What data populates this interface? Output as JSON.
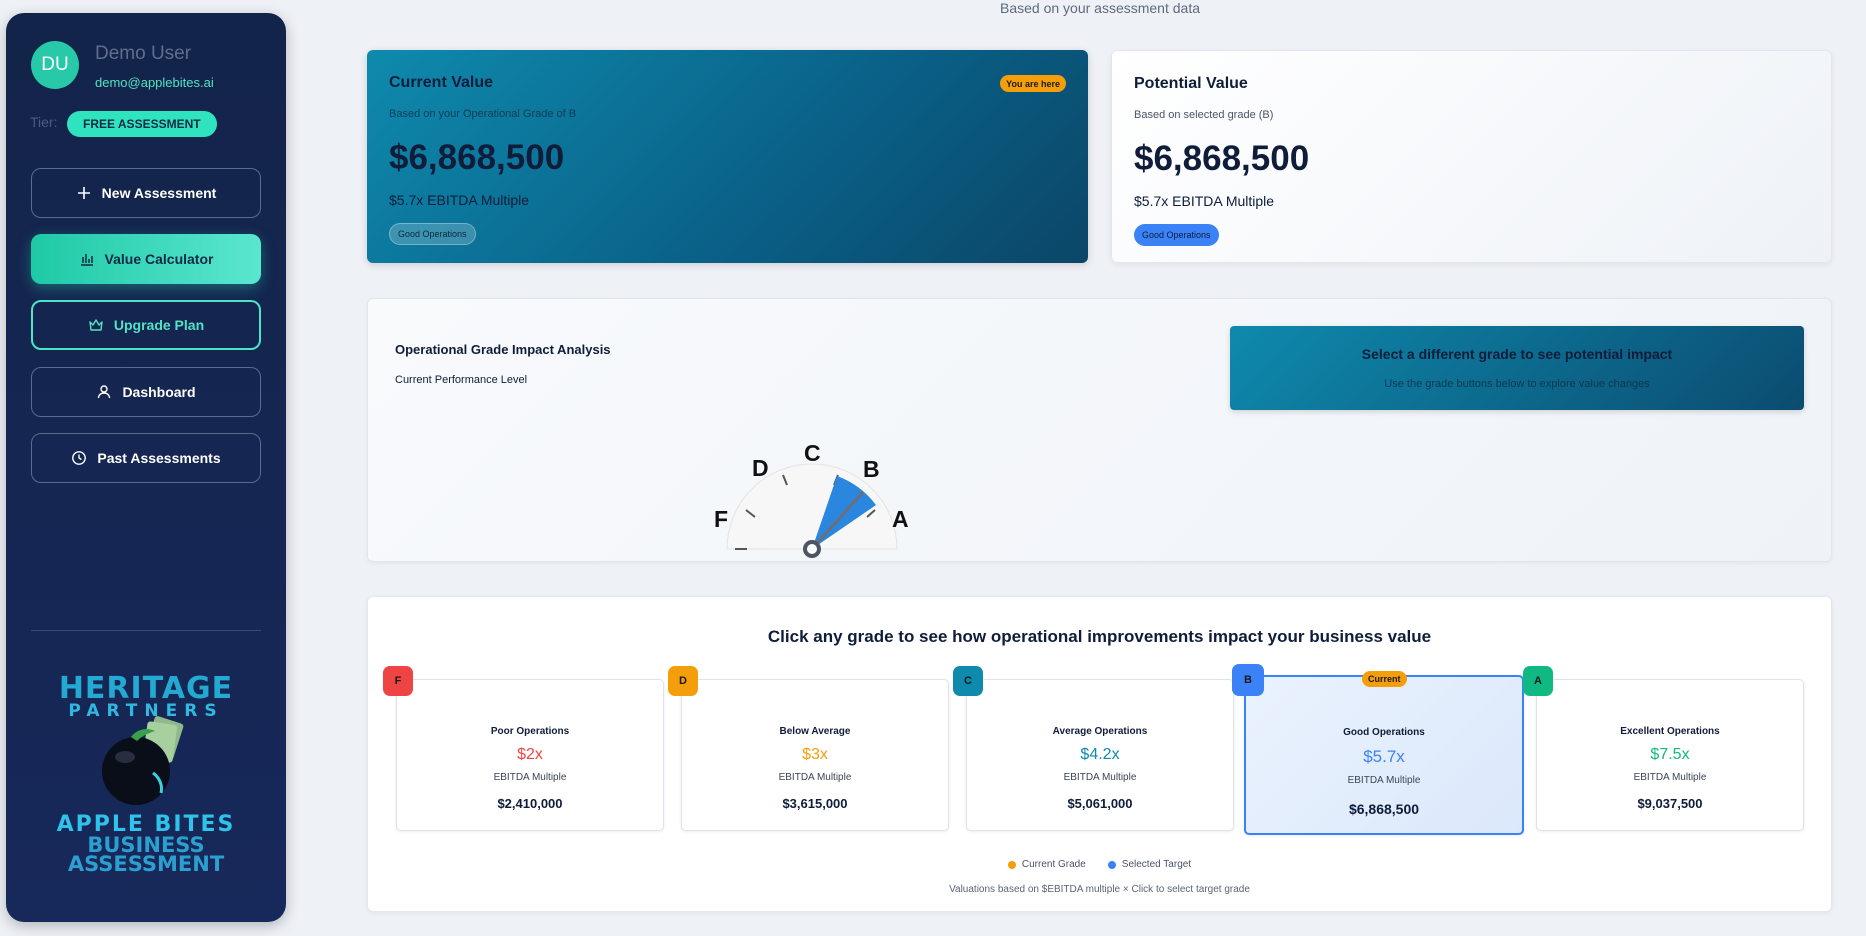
{
  "sidebar": {
    "avatar_initials": "DU",
    "user_name": "Demo User",
    "user_email": "demo@applebites.ai",
    "tier_label": "Tier:",
    "tier_badge": "FREE ASSESSMENT",
    "nav": {
      "new_assessment": "New Assessment",
      "value_calculator": "Value Calculator",
      "upgrade_plan": "Upgrade Plan",
      "dashboard": "Dashboard",
      "past_assessments": "Past Assessments"
    },
    "logo": {
      "line1": "HERITAGE",
      "line2": "PARTNERS",
      "line3": "APPLE BITES",
      "line4": "BUSINESS",
      "line5": "ASSESSMENT"
    }
  },
  "header": {
    "subtitle": "Based on your assessment data"
  },
  "current_value": {
    "title": "Current Value",
    "badge": "You are here",
    "subtitle": "Based on your Operational Grade of B",
    "value": "$6,868,500",
    "multiple": "$5.7x EBITDA Multiple",
    "pill": "Good Operations"
  },
  "potential_value": {
    "title": "Potential Value",
    "subtitle": "Based on selected grade (B)",
    "value": "$6,868,500",
    "multiple": "$5.7x EBITDA Multiple",
    "pill": "Good Operations"
  },
  "analysis": {
    "title": "Operational Grade Impact Analysis",
    "subtitle": "Current Performance Level",
    "gauge_labels": [
      "F",
      "D",
      "C",
      "B",
      "A"
    ],
    "gauge_current_grade": "B",
    "impact_title": "Select a different grade to see potential impact",
    "impact_subtitle": "Use the grade buttons below to explore value changes"
  },
  "grades": {
    "title": "Click any grade to see how operational improvements impact your business value",
    "current_tag": "Current",
    "items": [
      {
        "grade": "F",
        "name": "Poor Operations",
        "multiple": "$2x",
        "multiple_label": "EBITDA Multiple",
        "value": "$2,410,000",
        "color": "#ef4444"
      },
      {
        "grade": "D",
        "name": "Below Average",
        "multiple": "$3x",
        "multiple_label": "EBITDA Multiple",
        "value": "$3,615,000",
        "color": "#f59e0b"
      },
      {
        "grade": "C",
        "name": "Average Operations",
        "multiple": "$4.2x",
        "multiple_label": "EBITDA Multiple",
        "value": "$5,061,000",
        "color": "#0e8aad"
      },
      {
        "grade": "B",
        "name": "Good Operations",
        "multiple": "$5.7x",
        "multiple_label": "EBITDA Multiple",
        "value": "$6,868,500",
        "color": "#3b82f6"
      },
      {
        "grade": "A",
        "name": "Excellent Operations",
        "multiple": "$7.5x",
        "multiple_label": "EBITDA Multiple",
        "value": "$9,037,500",
        "color": "#10b981"
      }
    ],
    "legend": {
      "current": "Current Grade",
      "selected": "Selected Target",
      "current_color": "#f59e0b",
      "selected_color": "#3b82f6"
    },
    "footnote": "Valuations based on $EBITDA multiple × Click to select target grade"
  }
}
